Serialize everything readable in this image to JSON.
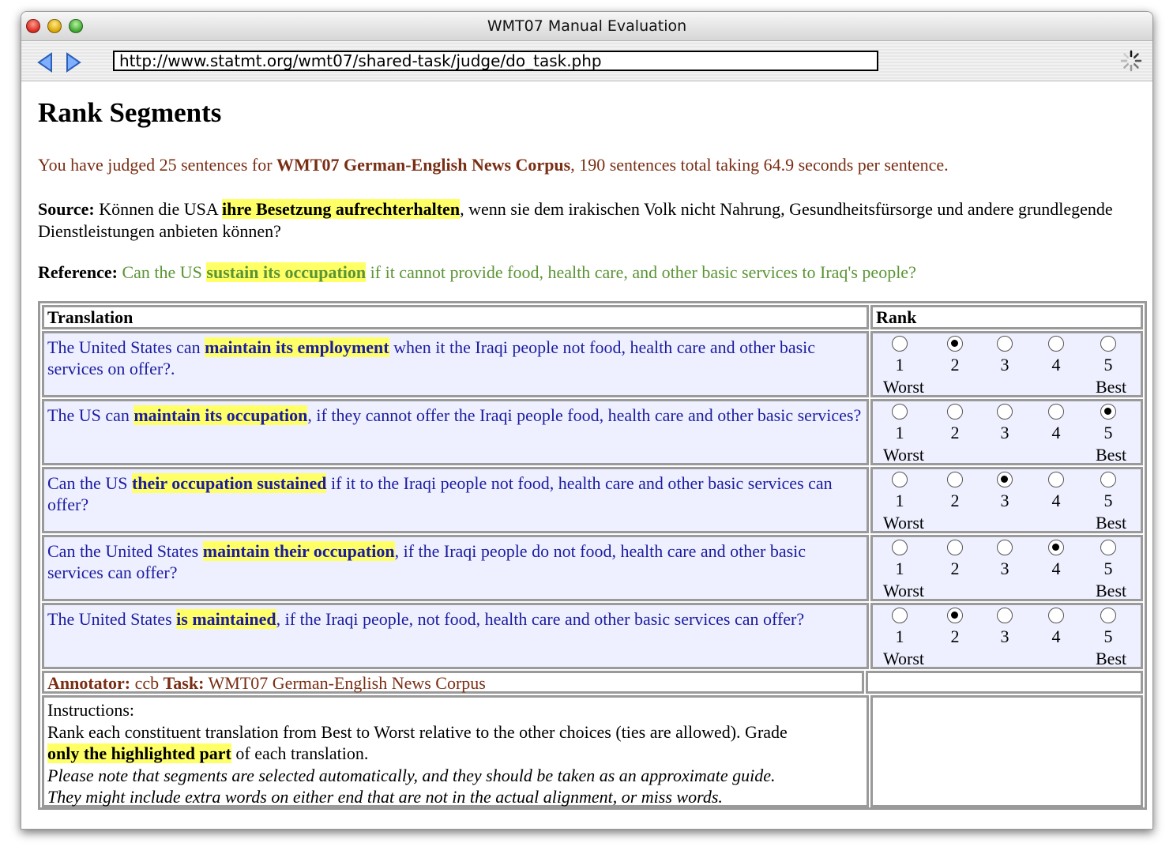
{
  "window": {
    "title": "WMT07 Manual Evaluation",
    "url": "http://www.statmt.org/wmt07/shared-task/judge/do_task.php"
  },
  "page": {
    "heading": "Rank Segments",
    "status": {
      "prefix": "You have judged 25 sentences for ",
      "corpus": "WMT07 German-English News Corpus",
      "suffix": ", 190 sentences total taking 64.9 seconds per sentence."
    },
    "source": {
      "label": "Source:",
      "before": " Können die USA ",
      "highlight": "ihre Besetzung aufrechterhalten",
      "after": ", wenn sie dem irakischen Volk nicht Nahrung, Gesundheitsfürsorge und andere grundlegende Dienstleistungen anbieten können?"
    },
    "reference": {
      "label": "Reference:",
      "before": " Can the US ",
      "highlight": "sustain its occupation",
      "after": " if it cannot provide food, health care, and other basic services to Iraq's people?"
    },
    "table": {
      "col_translation": "Translation",
      "col_rank": "Rank",
      "rank_numbers": [
        "1",
        "2",
        "3",
        "4",
        "5"
      ],
      "worst_label": "Worst",
      "best_label": "Best",
      "rows": [
        {
          "before": "The United States can ",
          "highlight": "maintain its employment",
          "after": " when it the Iraqi people not food, health care and other basic services on offer?.",
          "selected": 2
        },
        {
          "before": "The US can ",
          "highlight": "maintain its occupation",
          "after": ", if they cannot offer the Iraqi people food, health care and other basic services?",
          "selected": 5
        },
        {
          "before": "Can the US ",
          "highlight": "their occupation sustained",
          "after": " if it to the Iraqi people not food, health care and other basic services can offer?",
          "selected": 3
        },
        {
          "before": "Can the United States ",
          "highlight": "maintain their occupation",
          "after": ", if the Iraqi people do not food, health care and other basic services can offer?",
          "selected": 4
        },
        {
          "before": "The United States ",
          "highlight": "is maintained",
          "after": ", if the Iraqi people, not food, health care and other basic services can offer?",
          "selected": 2
        }
      ]
    },
    "footer": {
      "annotator_label": "Annotator:",
      "annotator": " ccb ",
      "task_label": "Task:",
      "task": " WMT07 German-English News Corpus"
    },
    "instructions": {
      "title": "Instructions:",
      "line1": "Rank each constituent translation from Best to Worst relative to the other choices (ties are allowed). Grade",
      "highlight": "only the highlighted part",
      "line2_after": " of each translation.",
      "note1": "Please note that segments are selected automatically, and they should be taken as an approximate guide.",
      "note2": "They might include extra words on either end that are not in the actual alignment, or miss words."
    }
  }
}
